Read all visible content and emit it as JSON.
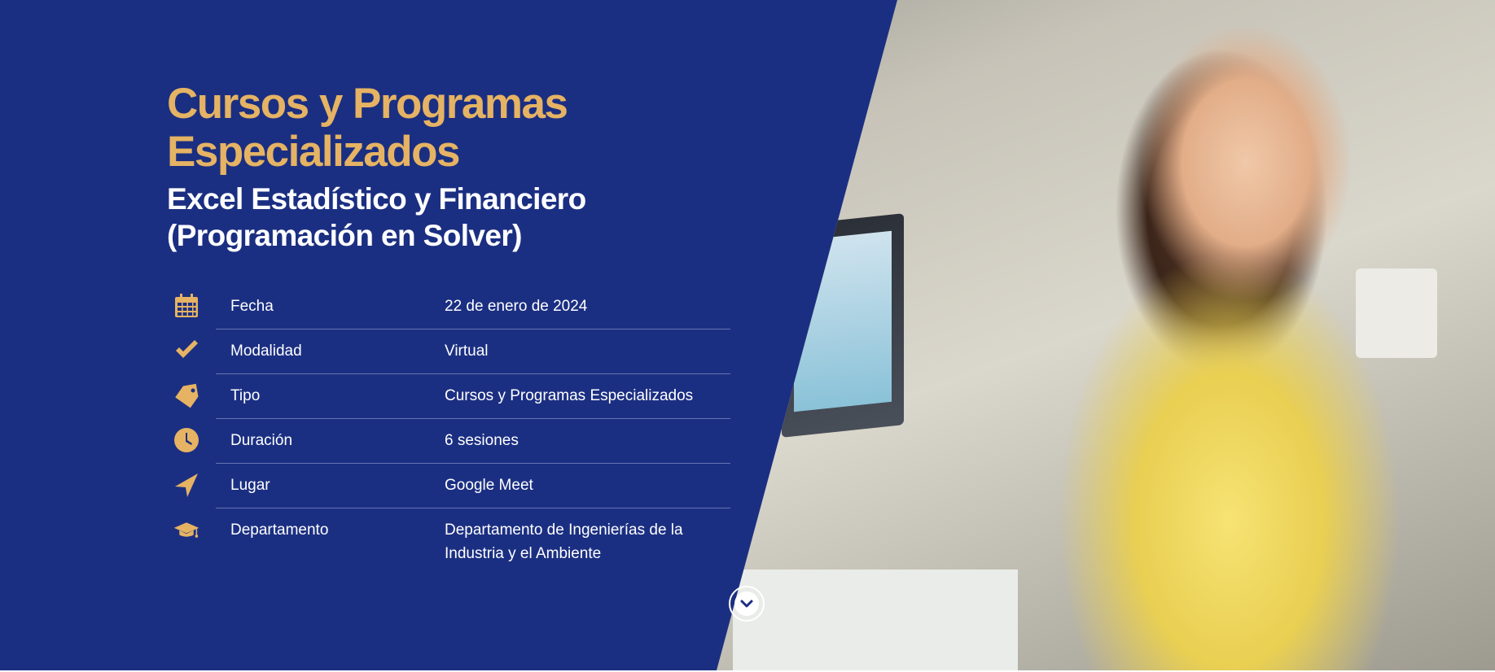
{
  "hero": {
    "title": "Cursos y Programas Especializados",
    "subtitle": "Excel Estadístico y Financiero (Programación en Solver)"
  },
  "details": [
    {
      "icon": "calendar-icon",
      "label": "Fecha",
      "value": "22 de enero de 2024"
    },
    {
      "icon": "check-icon",
      "label": "Modalidad",
      "value": "Virtual"
    },
    {
      "icon": "tag-icon",
      "label": "Tipo",
      "value": "Cursos y Programas Especializados"
    },
    {
      "icon": "clock-icon",
      "label": "Duración",
      "value": "6 sesiones"
    },
    {
      "icon": "location-arrow-icon",
      "label": "Lugar",
      "value": "Google Meet"
    },
    {
      "icon": "graduation-cap-icon",
      "label": "Departamento",
      "value": "Departamento de Ingenierías de la Industria y el Ambiente"
    }
  ],
  "colors": {
    "background": "#1b2f82",
    "accent": "#e5b363",
    "text": "#ffffff"
  }
}
